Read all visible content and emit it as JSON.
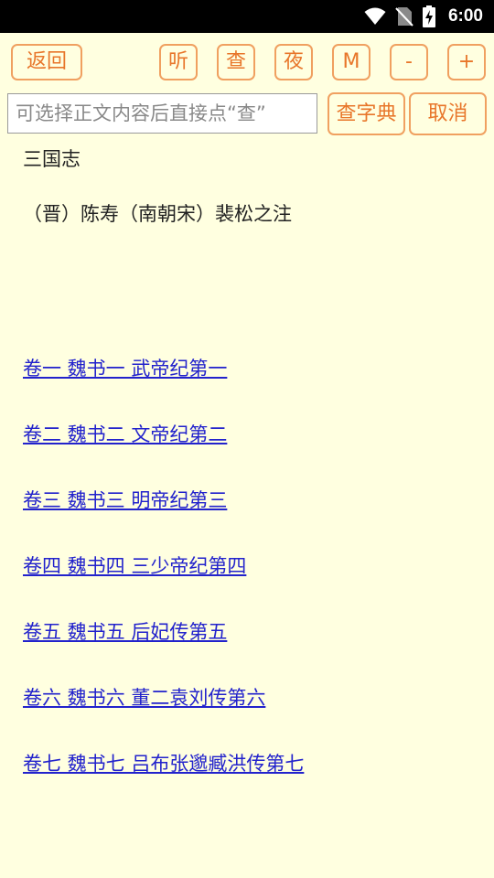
{
  "status_bar": {
    "time": "6:00"
  },
  "toolbar": {
    "back_label": "返回",
    "listen_label": "听",
    "lookup_label": "查",
    "night_label": "夜",
    "m_label": "M",
    "font_smaller_label": "-",
    "font_larger_label": "+"
  },
  "search": {
    "placeholder": "可选择正文内容后直接点“查”",
    "dictionary_label": "查字典",
    "cancel_label": "取消"
  },
  "book": {
    "title": "三国志",
    "author": "（晋）陈寿（南朝宋）裴松之注"
  },
  "chapters": [
    "卷一 魏书一 武帝纪第一",
    "卷二 魏书二 文帝纪第二",
    "卷三 魏书三 明帝纪第三",
    "卷四 魏书四 三少帝纪第四",
    "卷五 魏书五 后妃传第五",
    "卷六 魏书六 董二袁刘传第六",
    "卷七 魏书七 吕布张邈臧洪传第七"
  ],
  "colors": {
    "background": "#FFFFE0",
    "accent": "#E8762A",
    "link": "#2222CC"
  }
}
